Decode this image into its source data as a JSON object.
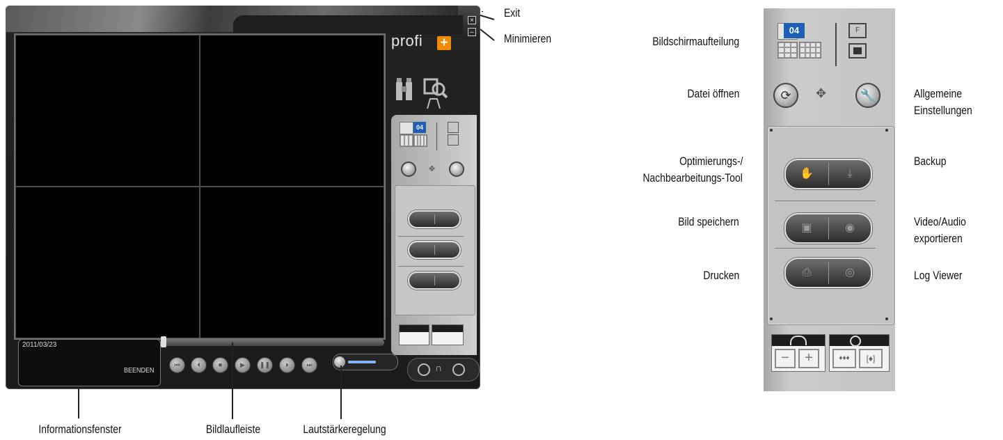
{
  "window": {
    "exit_glyph": "×",
    "minimize_glyph": "–"
  },
  "brand": {
    "name": "profi",
    "plus_glyph": "+"
  },
  "info_window": {
    "date": "2011/03/23",
    "exit_label": "BEENDEN"
  },
  "layout_badge": "04",
  "callouts": {
    "exit": "Exit",
    "minimize": "Minimieren",
    "info_window": "Informationsfenster",
    "scrollbar": "Bildlaufleiste",
    "volume": "Lautstärkeregelung",
    "screen_layout": "Bildschirmaufteilung",
    "open_file": "Datei öffnen",
    "general_settings_1": "Allgemeine",
    "general_settings_2": "Einstellungen",
    "optimize_1": "Optimierungs-/",
    "optimize_2": "Nachbearbeitungs-Tool",
    "backup": "Backup",
    "save_image": "Bild speichern",
    "export_1": "Video/Audio",
    "export_2": "exportieren",
    "print": "Drucken",
    "log_viewer": "Log Viewer"
  },
  "playback_buttons": [
    "skip-start",
    "prev-frame",
    "stop",
    "play",
    "pause",
    "next-frame",
    "skip-end"
  ],
  "colors": {
    "accent_orange": "#f08a00",
    "layout_blue": "#1e60b8",
    "volume_fill": "#7fb6ff"
  }
}
